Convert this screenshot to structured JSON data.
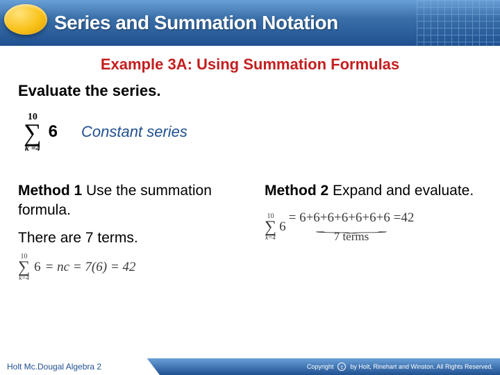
{
  "header": {
    "title": "Series and Summation Notation"
  },
  "example": {
    "heading": "Example 3A: Using Summation Formulas",
    "instruction": "Evaluate the series.",
    "series": {
      "upper": "10",
      "lower": "k =4",
      "term": "6",
      "label": "Constant series"
    }
  },
  "method1": {
    "title_bold": "Method 1",
    "title_rest": " Use the summation formula.",
    "count_text": "There are 7 terms.",
    "calc_upper": "10",
    "calc_lower": "k=4",
    "calc_term": "6",
    "calc_eq": "=  nc  =  7(6)  =  42"
  },
  "method2": {
    "title_bold": "Method 2",
    "title_rest": " Expand and evaluate.",
    "calc_upper": "10",
    "calc_lower": "k=4",
    "calc_term": "6",
    "expand": "= 6+6+6+6+6+6+6 =",
    "result": "42",
    "brace_label": "7 terms"
  },
  "footer": {
    "left": "Holt Mc.Dougal Algebra 2",
    "right": "by Holt, Rinehart and Winston. All Rights Reserved.",
    "copy": "Copyright"
  }
}
